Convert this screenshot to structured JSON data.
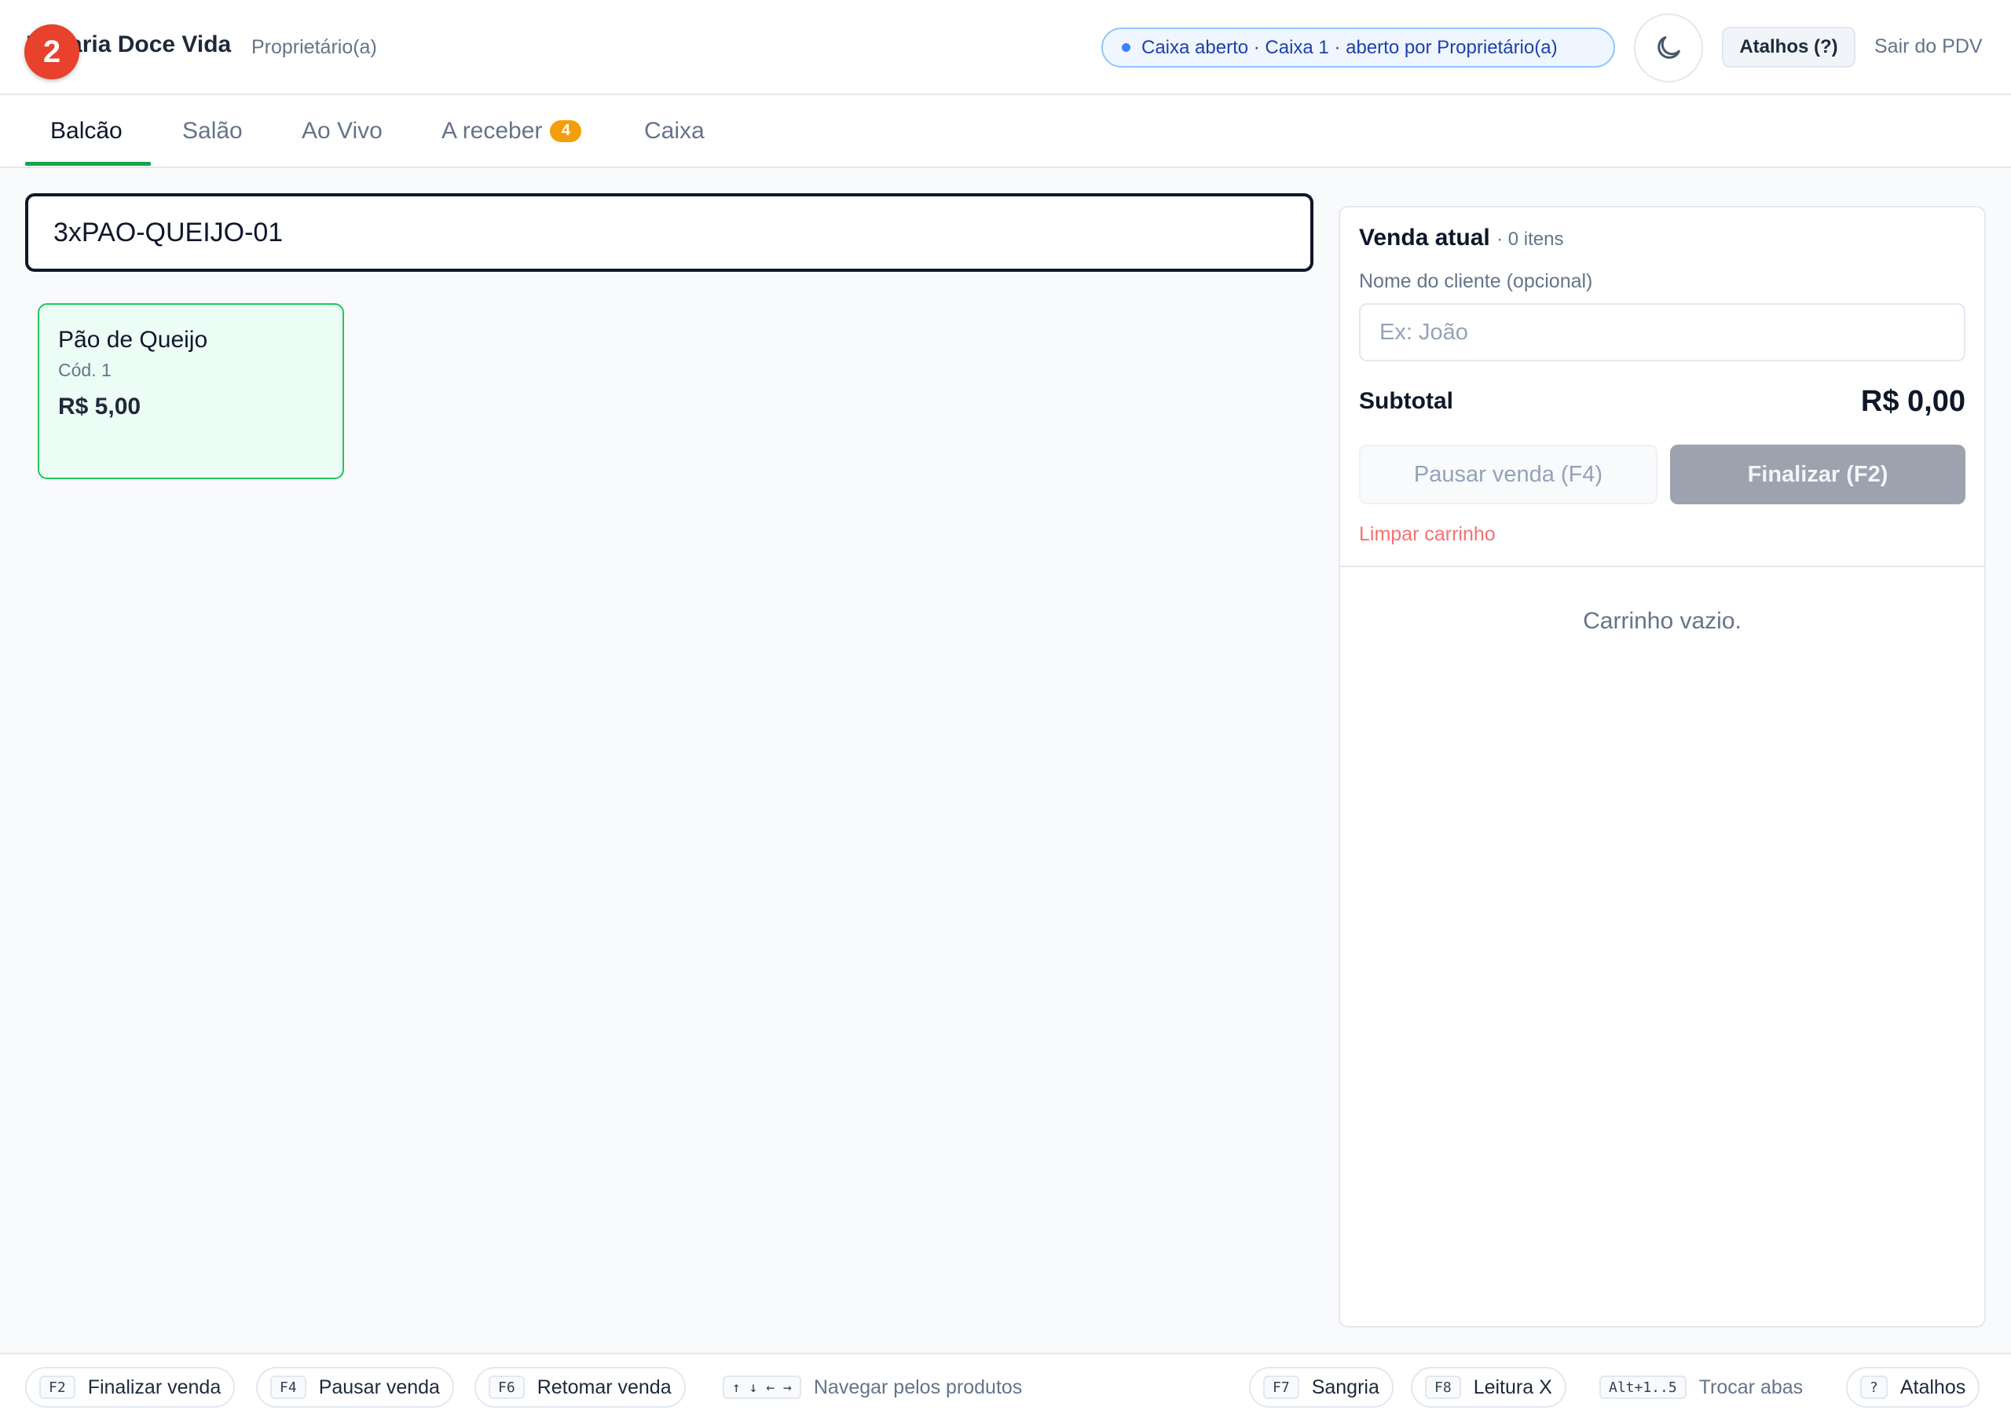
{
  "header": {
    "store_name": "Padaria Doce Vida",
    "role": "Proprietário(a)",
    "notification_count": "2",
    "status": "Caixa aberto · Caixa 1 · aberto por Proprietário(a)",
    "theme_icon": "moon-icon",
    "shortcuts_label": "Atalhos (?)",
    "exit_label": "Sair do PDV"
  },
  "tabs": [
    {
      "label": "Balcão",
      "active": true
    },
    {
      "label": "Salão"
    },
    {
      "label": "Ao Vivo"
    },
    {
      "label": "A receber",
      "badge": "4"
    },
    {
      "label": "Caixa"
    }
  ],
  "search": {
    "value": "3xPAO-QUEIJO-01"
  },
  "products": [
    {
      "name": "Pão de Queijo",
      "code": "Cód. 1",
      "price": "R$ 5,00"
    }
  ],
  "cart": {
    "title": "Venda atual",
    "count": "· 0 itens",
    "client_label": "Nome do cliente (opcional)",
    "client_placeholder": "Ex: João",
    "subtotal_label": "Subtotal",
    "subtotal_value": "R$ 0,00",
    "pause_label": "Pausar venda (F4)",
    "finalize_label": "Finalizar (F2)",
    "clear_label": "Limpar carrinho",
    "empty_text": "Carrinho vazio."
  },
  "footer": {
    "shortcuts": [
      {
        "key": "F2",
        "label": "Finalizar venda"
      },
      {
        "key": "F4",
        "label": "Pausar venda"
      },
      {
        "key": "F6",
        "label": "Retomar venda"
      },
      {
        "key": "↑ ↓ ← →",
        "label": "Navegar pelos produtos"
      },
      {
        "key": "F7",
        "label": "Sangria"
      },
      {
        "key": "F8",
        "label": "Leitura X"
      },
      {
        "key": "Alt+1..5",
        "label": "Trocar abas"
      },
      {
        "key": "?",
        "label": "Atalhos"
      }
    ]
  },
  "colors": {
    "accent_green": "#16a34a",
    "badge_orange": "#f59e0b",
    "status_blue": "#1e40af",
    "danger": "#f87171"
  }
}
